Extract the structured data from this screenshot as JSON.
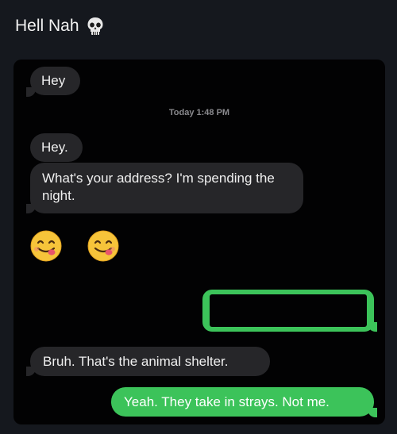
{
  "post": {
    "title": "Hell Nah",
    "title_icon": "skull-icon"
  },
  "conversation": {
    "timestamp": "Today 1:48 PM",
    "messages": [
      {
        "side": "received",
        "text": "Hey"
      },
      {
        "side": "received",
        "text": "Hey."
      },
      {
        "side": "received",
        "text": "What's your address? I'm spending the night."
      },
      {
        "side": "received",
        "emoji": "smiling-face-with-tongue-icon",
        "count": 2
      },
      {
        "side": "sent",
        "text": ""
      },
      {
        "side": "received",
        "text": "Bruh. That's the animal shelter."
      },
      {
        "side": "sent",
        "text": "Yeah. They take in strays. Not me."
      }
    ],
    "colors": {
      "received_bubble": "#262629",
      "sent_bubble": "#3cc35a",
      "background": "#020203"
    }
  }
}
